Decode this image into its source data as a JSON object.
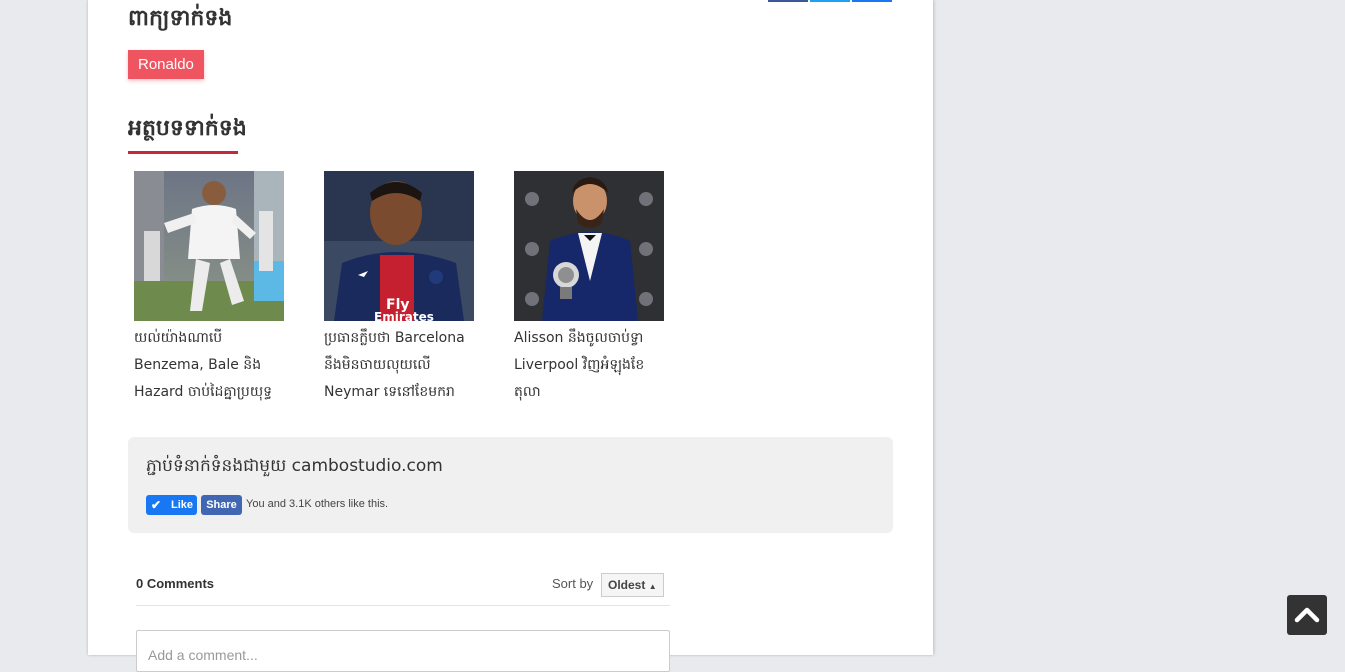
{
  "tags": {
    "title": "ពាក្យទាក់ទង",
    "items": [
      "Ronaldo"
    ]
  },
  "related": {
    "title": "អត្ថបទទាក់ទង",
    "articles": [
      {
        "caption_lines": [
          "យល់យ៉ាងណាបើ",
          "Benzema, Bale និង",
          "Hazard ចាប់ដៃគ្នាប្រយុទ្ធ"
        ]
      },
      {
        "caption_lines": [
          "ប្រធានក្លឹបថា Barcelona",
          "នឹងមិនចាយលុយលើ",
          "Neymar ទេនៅខែមករា"
        ]
      },
      {
        "caption_lines": [
          "Alisson នឹងចូលចាប់ទ្វា",
          "Liverpool វិញអំឡុងខែ",
          "តុលា"
        ]
      }
    ]
  },
  "facebook": {
    "title": "ភ្ជាប់ទំនាក់ទំនងជាមួយ cambostudio.com",
    "like_label": "Like",
    "share_label": "Share",
    "count_text": "You and 3.1K others like this."
  },
  "comments": {
    "count_label": "0 Comments",
    "sort_label": "Sort by",
    "sort_value": "Oldest",
    "input_placeholder": "Add a comment..."
  },
  "colors": {
    "tag_bg": "#ee5560",
    "accent_underline": "#c8263b",
    "facebook_blue": "#4267b2",
    "page_bg": "#e9eaed"
  },
  "icons": {
    "like": "check-icon",
    "back_to_top": "chevron-up-icon",
    "sort": "sort-arrows-icon"
  }
}
